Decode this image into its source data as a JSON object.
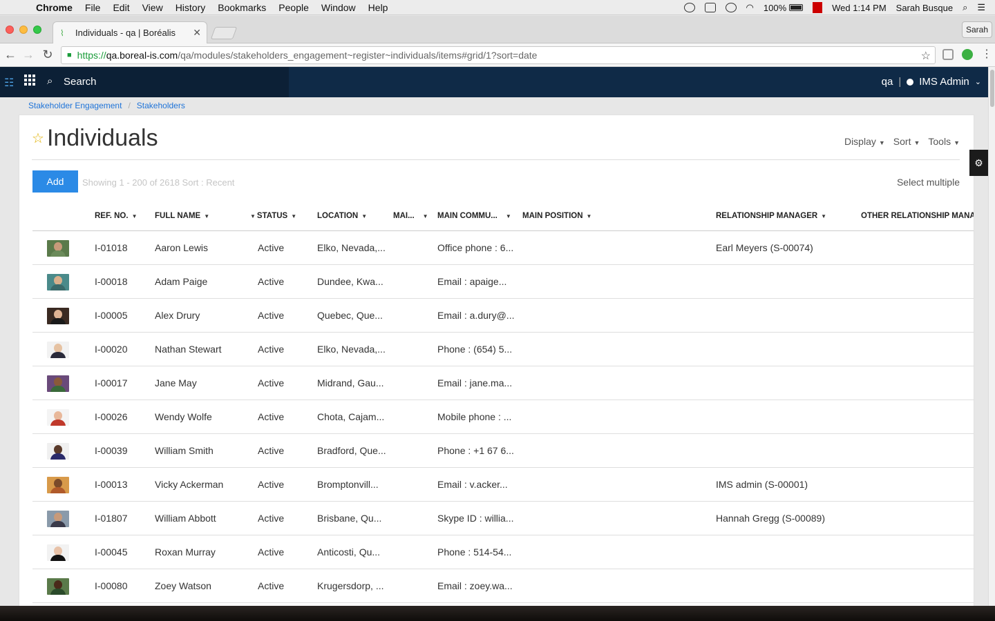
{
  "menubar": {
    "app": "Chrome",
    "items": [
      "File",
      "Edit",
      "View",
      "History",
      "Bookmarks",
      "People",
      "Window",
      "Help"
    ],
    "battery": "100%",
    "clock": "Wed 1:14 PM",
    "user": "Sarah Busque"
  },
  "browser": {
    "tab_title": "Individuals - qa | Boréalis",
    "profile": "Sarah",
    "url_scheme": "https://",
    "url_host": "qa.boreal-is.com",
    "url_path": "/qa/modules/stakeholders_engagement~register~individuals/items#grid/1?sort=date"
  },
  "appbar": {
    "search_label": "Search",
    "workspace": "qa",
    "separator": "|",
    "user": "IMS Admin"
  },
  "breadcrumb": [
    "Stakeholder Engagement",
    "Stakeholders"
  ],
  "page": {
    "title": "Individuals",
    "tools": [
      "Display",
      "Sort",
      "Tools"
    ],
    "add_label": "Add",
    "showing_text": "Showing 1 - 200 of 2618  Sort :   Recent",
    "select_multiple": "Select multiple"
  },
  "columns": [
    "REF. NO.",
    "FULL NAME",
    "STATUS",
    "LOCATION",
    "MAI...",
    "MAIN COMMU...",
    "MAIN POSITION",
    "RELATIONSHIP MANAGER",
    "OTHER RELATIONSHIP MANAG"
  ],
  "rows": [
    {
      "ref": "I-01018",
      "name": "Aaron Lewis",
      "status": "Active",
      "location": "Elko, Nevada,...",
      "comm": "Office phone : 6...",
      "manager": "Earl Meyers (S-00074)",
      "bg": "#5a7a4a",
      "skin": "#c79a7a",
      "shirt": "#6b8b5a"
    },
    {
      "ref": "I-00018",
      "name": "Adam Paige",
      "status": "Active",
      "location": "Dundee, Kwa...",
      "comm": "Email : apaige...",
      "manager": "",
      "bg": "#4a8a8a",
      "skin": "#d9b08c",
      "shirt": "#3a6a6a"
    },
    {
      "ref": "I-00005",
      "name": "Alex Drury",
      "status": "Active",
      "location": "Quebec, Que...",
      "comm": "Email : a.dury@...",
      "manager": "",
      "bg": "#3a2a22",
      "skin": "#e0b494",
      "shirt": "#1a1a1a"
    },
    {
      "ref": "I-00020",
      "name": "Nathan Stewart",
      "status": "Active",
      "location": "Elko, Nevada,...",
      "comm": "Phone : (654) 5...",
      "manager": "",
      "bg": "#f2f2f2",
      "skin": "#e6c2a2",
      "shirt": "#2a2a3a"
    },
    {
      "ref": "I-00017",
      "name": "Jane May",
      "status": "Active",
      "location": "Midrand, Gau...",
      "comm": "Email : jane.ma...",
      "manager": "",
      "bg": "#6a4a7a",
      "skin": "#8a5a3a",
      "shirt": "#3a6a3a"
    },
    {
      "ref": "I-00026",
      "name": "Wendy Wolfe",
      "status": "Active",
      "location": "Chota, Cajam...",
      "comm": "Mobile phone : ...",
      "manager": "",
      "bg": "#f4f4f4",
      "skin": "#e8b89a",
      "shirt": "#c0392b"
    },
    {
      "ref": "I-00039",
      "name": "William Smith",
      "status": "Active",
      "location": "Bradford, Que...",
      "comm": "Phone : +1 67 6...",
      "manager": "",
      "bg": "#f0f0f0",
      "skin": "#5a3a2a",
      "shirt": "#2a2a6a"
    },
    {
      "ref": "I-00013",
      "name": "Vicky Ackerman",
      "status": "Active",
      "location": "Bromptonvill...",
      "comm": "Email : v.acker...",
      "manager": "IMS admin (S-00001)",
      "bg": "#d89a4a",
      "skin": "#7a4a2a",
      "shirt": "#b05a2a"
    },
    {
      "ref": "I-01807",
      "name": "William Abbott",
      "status": "Active",
      "location": "Brisbane, Qu...",
      "comm": "Skype ID : willia...",
      "manager": "Hannah Gregg (S-00089)",
      "bg": "#8a9aaa",
      "skin": "#c89a7a",
      "shirt": "#3a3a4a"
    },
    {
      "ref": "I-00045",
      "name": "Roxan Murray",
      "status": "Active",
      "location": "Anticosti, Qu...",
      "comm": "Phone : 514-54...",
      "manager": "",
      "bg": "#f2f2f2",
      "skin": "#e8c2a8",
      "shirt": "#111111"
    },
    {
      "ref": "I-00080",
      "name": "Zoey Watson",
      "status": "Active",
      "location": "Krugersdorp, ...",
      "comm": "Email : zoey.wa...",
      "manager": "",
      "bg": "#5a7a4a",
      "skin": "#4a2a1a",
      "shirt": "#2a4a2a"
    }
  ]
}
